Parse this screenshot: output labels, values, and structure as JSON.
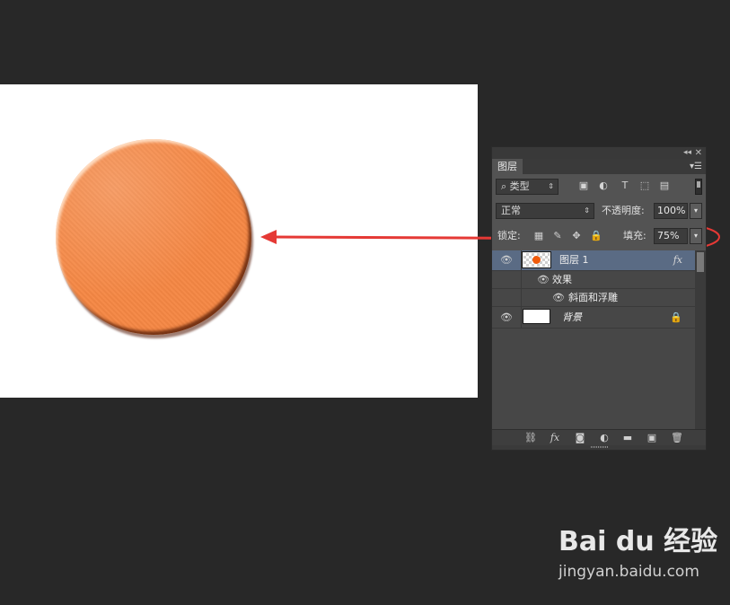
{
  "colors": {
    "workspace_bg": "#282828",
    "document_bg": "#ffffff",
    "circle_fill": "#f58744",
    "annotation_red": "#e53935",
    "panel_bg": "#535353"
  },
  "panel": {
    "tab_label": "图层",
    "collapse_icon": "double-chevron-left-icon",
    "close_icon": "close-icon",
    "menu_icon": "panel-menu-icon",
    "filter": {
      "kind_label": "类型",
      "icons": [
        "image-filter-icon",
        "adjustment-filter-icon",
        "type-filter-icon",
        "shape-filter-icon",
        "smart-object-filter-icon"
      ]
    },
    "blend": {
      "mode": "正常",
      "opacity_label": "不透明度:",
      "opacity_value": "100%"
    },
    "lock": {
      "label": "锁定:",
      "fill_label": "填充:",
      "fill_value": "75%"
    },
    "layers": [
      {
        "name": "图层 1",
        "fx": "fx",
        "selected": true
      },
      {
        "name": "效果"
      },
      {
        "name": "斜面和浮雕"
      },
      {
        "name": "背景",
        "locked": true
      }
    ],
    "bottom_icons": [
      "link-layers-icon",
      "fx-icon",
      "add-mask-icon",
      "adjustment-layer-icon",
      "new-group-icon",
      "new-layer-icon",
      "trash-icon"
    ],
    "bottom_fx_label": "fx"
  },
  "watermark": {
    "logo": "Bai du 经验",
    "url": "jingyan.baidu.com"
  }
}
